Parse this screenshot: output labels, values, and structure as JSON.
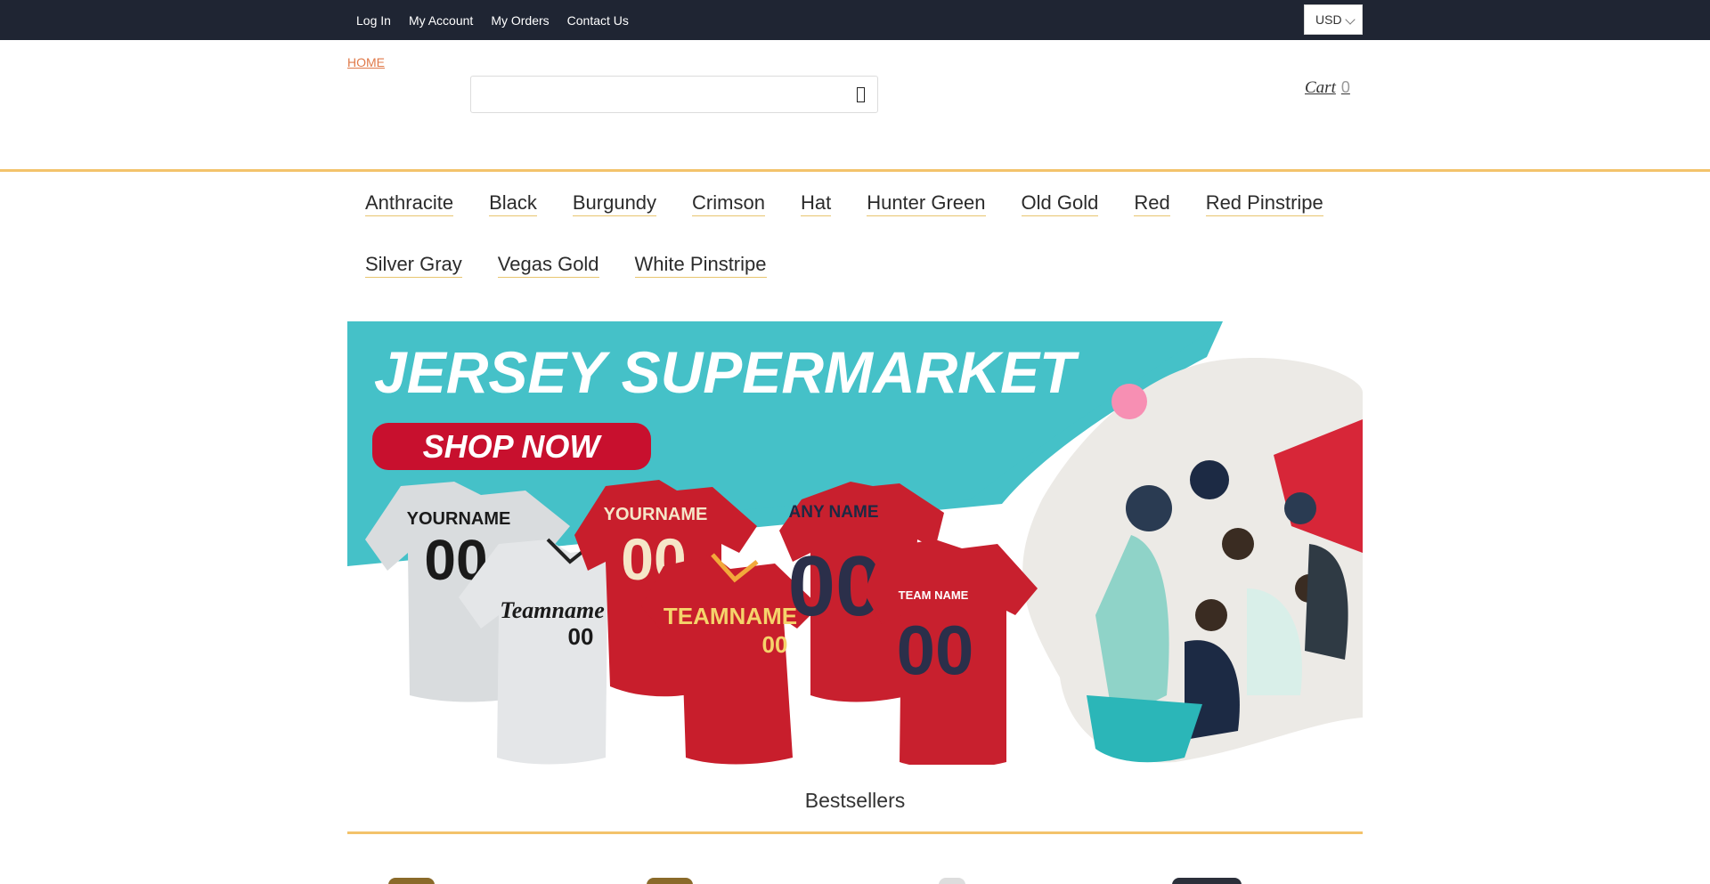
{
  "topbar": {
    "links": [
      "Log In",
      "My Account",
      "My Orders",
      "Contact Us"
    ],
    "currency": "USD"
  },
  "header": {
    "breadcrumb": "HOME",
    "search": {
      "value": "",
      "placeholder": ""
    },
    "search_icon": "search-icon",
    "cart_label": "Cart",
    "cart_count": "0"
  },
  "categories": {
    "row1": [
      "Anthracite",
      "Black",
      "Burgundy",
      "Crimson",
      "Hat",
      "Hunter Green",
      "Old Gold",
      "Red",
      "Red Pinstripe"
    ],
    "row2": [
      "Silver Gray",
      "Vegas Gold",
      "White Pinstripe"
    ]
  },
  "banner": {
    "headline": "JERSEY SUPERMARKET",
    "cta": "SHOP NOW",
    "jerseys": [
      {
        "name": "YOURNAME",
        "number": "00"
      },
      {
        "name": "Teamname",
        "number": "00"
      },
      {
        "name": "YOURNAME",
        "number": "00"
      },
      {
        "name": "TEAMNAME",
        "number": "00"
      },
      {
        "name": "ANY NAME",
        "number": "00"
      },
      {
        "name": "TEAM NAME",
        "number": "00"
      }
    ]
  },
  "section": {
    "title": "Bestsellers"
  },
  "colors": {
    "topbar": "#1f2533",
    "accent_gold": "#f3c36b",
    "breadcrumb": "#e07a4a",
    "banner_teal": "#45c1c8",
    "cta_red": "#c8102e"
  }
}
